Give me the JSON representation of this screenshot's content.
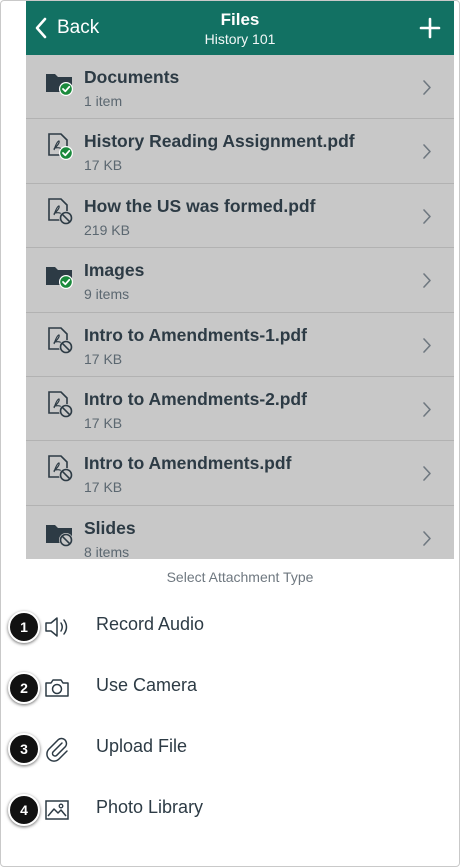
{
  "header": {
    "back_label": "Back",
    "title": "Files",
    "subtitle": "History 101",
    "bg_color": "#127163"
  },
  "files": [
    {
      "name": "Documents",
      "meta": "1 item",
      "icon": "folder-published-icon"
    },
    {
      "name": "History Reading Assignment.pdf",
      "meta": "17 KB",
      "icon": "pdf-published-icon"
    },
    {
      "name": "How the US was formed.pdf",
      "meta": "219 KB",
      "icon": "pdf-unpublished-icon"
    },
    {
      "name": "Images",
      "meta": "9 items",
      "icon": "folder-published-icon"
    },
    {
      "name": "Intro to Amendments-1.pdf",
      "meta": "17 KB",
      "icon": "pdf-unpublished-icon"
    },
    {
      "name": "Intro to Amendments-2.pdf",
      "meta": "17 KB",
      "icon": "pdf-unpublished-icon"
    },
    {
      "name": "Intro to Amendments.pdf",
      "meta": "17 KB",
      "icon": "pdf-unpublished-icon"
    },
    {
      "name": "Slides",
      "meta": "8 items",
      "icon": "folder-unpublished-icon"
    }
  ],
  "attachment_sheet": {
    "title": "Select Attachment Type",
    "options": [
      {
        "badge": "1",
        "label": "Record Audio",
        "icon": "speaker-icon"
      },
      {
        "badge": "2",
        "label": "Use Camera",
        "icon": "camera-icon"
      },
      {
        "badge": "3",
        "label": "Upload File",
        "icon": "paperclip-icon"
      },
      {
        "badge": "4",
        "label": "Photo Library",
        "icon": "image-icon"
      }
    ]
  },
  "colors": {
    "accent": "#127163",
    "published": "#1a8a3c",
    "list_bg": "#c8c8c8",
    "text": "#2d3b45"
  }
}
